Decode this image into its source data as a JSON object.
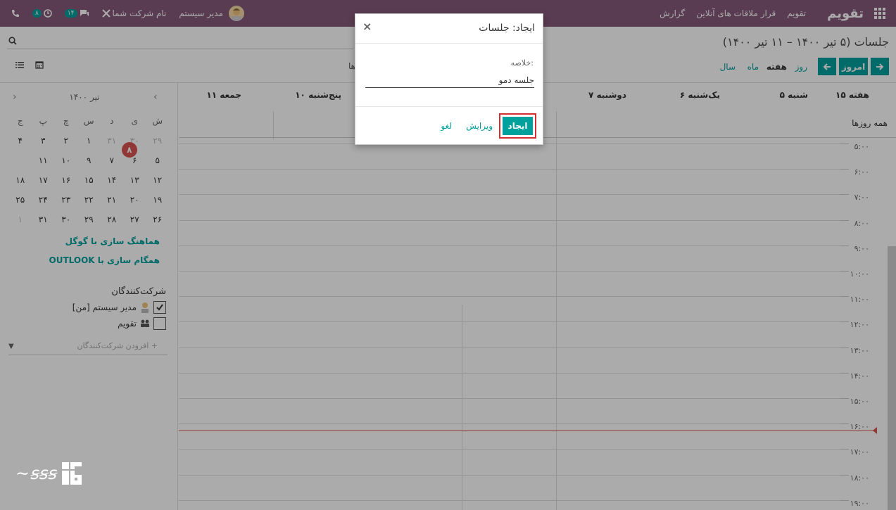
{
  "navbar": {
    "brand": "تقویم",
    "menu": [
      "تقویم",
      "قرار ملاقات های آنلاین",
      "گزارش"
    ],
    "activity_count": "۸",
    "message_count": "۱۴",
    "company": "نام شرکت شما",
    "user": "مدیر سیستم"
  },
  "control": {
    "breadcrumb": "جلسات (۵ تیر ۱۴۰۰ – ۱۱ تیر ۱۴۰۰)",
    "today_label": "امروز",
    "scales": [
      "روز",
      "هفته",
      "ماه",
      "سال"
    ],
    "filters_partial": "ها"
  },
  "mini_calendar": {
    "month": "تیر ۱۴۰۰",
    "weekdays": [
      "ش",
      "ی",
      "د",
      "س",
      "چ",
      "پ",
      "ج"
    ],
    "weeks": [
      [
        "۲۹",
        "۳۰",
        "۳۱",
        "۱",
        "۲",
        "۳",
        "۴"
      ],
      [
        "۵",
        "۶",
        "۷",
        "۸",
        "۹",
        "۱۰",
        "۱۱"
      ],
      [
        "۱۲",
        "۱۳",
        "۱۴",
        "۱۵",
        "۱۶",
        "۱۷",
        "۱۸"
      ],
      [
        "۱۹",
        "۲۰",
        "۲۱",
        "۲۲",
        "۲۳",
        "۲۴",
        "۲۵"
      ],
      [
        "۲۶",
        "۲۷",
        "۲۸",
        "۲۹",
        "۳۰",
        "۳۱",
        "۱"
      ]
    ],
    "today": "۸"
  },
  "sync": {
    "google": "هماهنگ سازی با گوگل",
    "outlook": "همگام سازی با OUTLOOK"
  },
  "attendees": {
    "title": "شرکت‌کنندگان",
    "items": [
      {
        "label": "مدیر سیستم [من]",
        "checked": true
      },
      {
        "label": "تقویم",
        "checked": false
      }
    ],
    "add_placeholder": "+ افزودن شرکت‌کنندگان"
  },
  "calendar": {
    "week_label": "هفته ۱۵",
    "days": [
      "شنبه ۵",
      "یک‌شنبه ۶",
      "دوشنبه ۷",
      "پنج‌شنبه ۱۰",
      "جمعه ۱۱"
    ],
    "all_day": "همه روزها",
    "hours": [
      "۵:۰۰",
      "۶:۰۰",
      "۷:۰۰",
      "۸:۰۰",
      "۹:۰۰",
      "۱۰:۰۰",
      "۱۱:۰۰",
      "۱۲:۰۰",
      "۱۳:۰۰",
      "۱۴:۰۰",
      "۱۵:۰۰",
      "۱۶:۰۰",
      "۱۷:۰۰",
      "۱۸:۰۰",
      "۱۹:۰۰"
    ]
  },
  "modal": {
    "title": "ایجاد: جلسات",
    "field_label": "خلاصه:",
    "field_value": "جلسه دمو",
    "create": "ایجاد",
    "edit": "ویرایش",
    "cancel": "لغو"
  },
  "colors": {
    "navbar": "#875a7b",
    "accent": "#00a09d",
    "today": "#d9534f",
    "highlight": "#d32f2f"
  }
}
